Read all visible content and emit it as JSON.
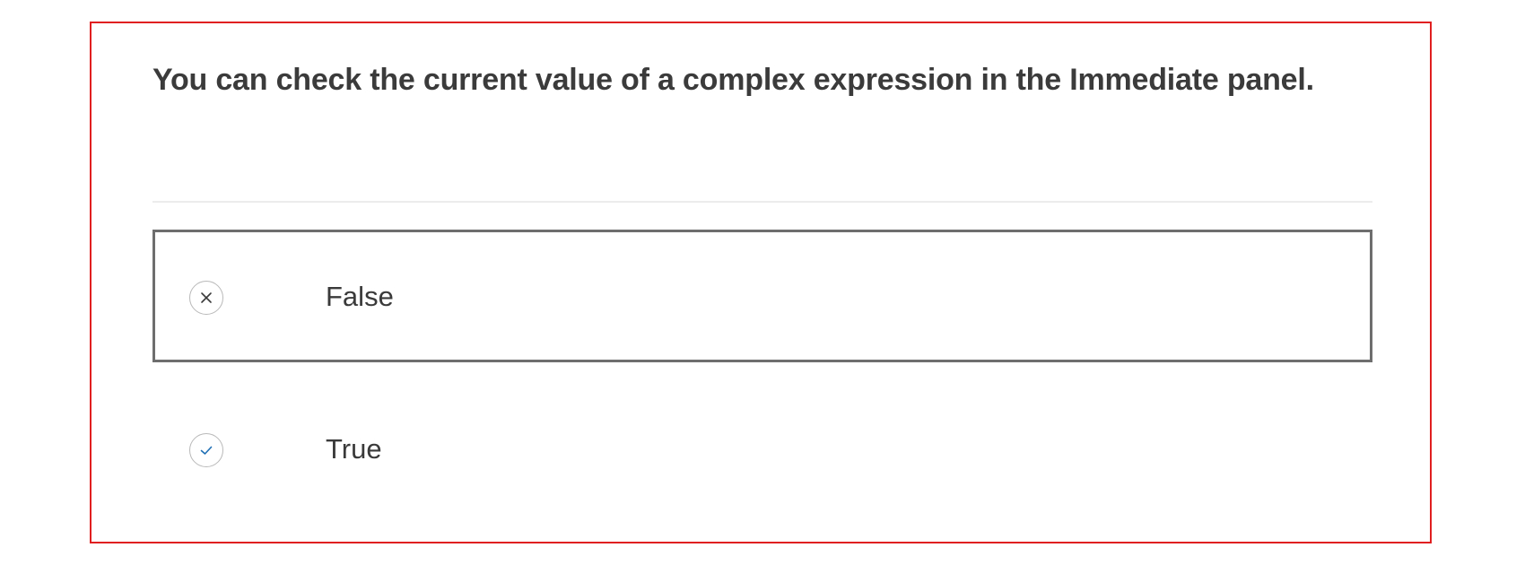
{
  "question": {
    "text": "You can check the current value of a complex expression in the Immediate panel."
  },
  "options": [
    {
      "label": "False",
      "icon": "close-icon",
      "selected": true,
      "icon_color": "#3a3a3a"
    },
    {
      "label": "True",
      "icon": "checkmark-icon",
      "selected": false,
      "icon_color": "#1f6fb5"
    }
  ],
  "colors": {
    "frame_border": "#e02020",
    "selected_border": "#6e6e6e",
    "divider": "#ececec",
    "text": "#3a3a3a"
  }
}
